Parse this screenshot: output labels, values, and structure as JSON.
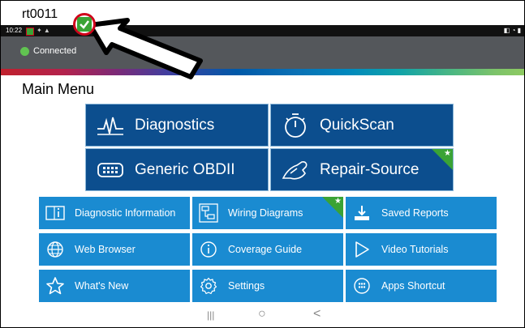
{
  "document_label": "rt0011",
  "status_bar": {
    "time": "10:22"
  },
  "header": {
    "connection_status": "Connected"
  },
  "main_title": "Main Menu",
  "big_tiles": [
    {
      "label": "Diagnostics",
      "icon": "waveform-icon"
    },
    {
      "label": "QuickScan",
      "icon": "stopwatch-icon"
    },
    {
      "label": "Generic OBDII",
      "icon": "obd-connector-icon"
    },
    {
      "label": "Repair-Source",
      "icon": "wrench-hand-icon",
      "badge": "star"
    }
  ],
  "small_tiles": [
    {
      "label": "Diagnostic Information",
      "icon": "info-icon"
    },
    {
      "label": "Wiring Diagrams",
      "icon": "wiring-diagram-icon",
      "badge": "star"
    },
    {
      "label": "Saved Reports",
      "icon": "download-icon"
    },
    {
      "label": "Web Browser",
      "icon": "globe-icon"
    },
    {
      "label": "Coverage Guide",
      "icon": "info-circle-icon"
    },
    {
      "label": "Video Tutorials",
      "icon": "play-icon"
    },
    {
      "label": "What's New",
      "icon": "star-outline-icon"
    },
    {
      "label": "Settings",
      "icon": "gear-icon"
    },
    {
      "label": "Apps Shortcut",
      "icon": "apps-icon"
    }
  ],
  "colors": {
    "big_tile": "#0c4e8e",
    "small_tile": "#1a8bd1",
    "header": "#54575b",
    "badge": "#3aa335",
    "connected": "#61c351",
    "callout": "#d0021b"
  },
  "nav_bar": {
    "recents": "|||",
    "home": "○",
    "back": "<"
  }
}
